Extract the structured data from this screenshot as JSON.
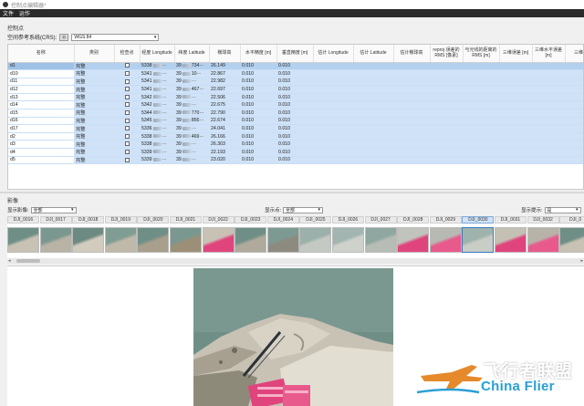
{
  "window": {
    "title": "控制点编辑器*"
  },
  "menu": [
    "文件",
    "运作"
  ],
  "control_points": {
    "section_label": "控制点",
    "crs_label": "空间参考系统(CRS):",
    "crs_value": "WGS 84",
    "columns": [
      "名称",
      "类别",
      "检查点",
      "经度 Longitude",
      "纬度 Latitude",
      "椭球高",
      "水平精度 [m]",
      "垂直精度 [m]",
      "估计 Longitude",
      "估计 Latitude",
      "估计椭球高",
      "reproj 误差的 RMS [像素]",
      "与光线的距离的 RMS [m]",
      "三维误差 [m]",
      "三维水平误差 [m]",
      "三维"
    ],
    "rows": [
      {
        "name": "d1",
        "type": "完整",
        "lon": "5338",
        "lat": "39",
        "tail": "734",
        "h": "26.149",
        "hacc": "0.010",
        "vacc": "0.010"
      },
      {
        "name": "d10",
        "type": "完整",
        "lon": "5341",
        "lat": "39",
        "tail": "10",
        "h": "22.867",
        "hacc": "0.010",
        "vacc": "0.010"
      },
      {
        "name": "d11",
        "type": "完整",
        "lon": "5341",
        "lat": "39",
        "tail": "",
        "h": "22.982",
        "hacc": "0.010",
        "vacc": "0.010"
      },
      {
        "name": "d12",
        "type": "完整",
        "lon": "5341",
        "lat": "39",
        "tail": "467",
        "h": "22.697",
        "hacc": "0.010",
        "vacc": "0.010"
      },
      {
        "name": "d13",
        "type": "完整",
        "lon": "5342",
        "lat": "39",
        "tail": "",
        "h": "22.506",
        "hacc": "0.010",
        "vacc": "0.010"
      },
      {
        "name": "d14",
        "type": "完整",
        "lon": "5342",
        "lat": "39",
        "tail": "",
        "h": "22.675",
        "hacc": "0.010",
        "vacc": "0.010"
      },
      {
        "name": "d15",
        "type": "完整",
        "lon": "5344",
        "lat": "39",
        "tail": "770",
        "h": "22.790",
        "hacc": "0.010",
        "vacc": "0.010"
      },
      {
        "name": "d16",
        "type": "完整",
        "lon": "5345",
        "lat": "39",
        "tail": "856",
        "h": "22.674",
        "hacc": "0.010",
        "vacc": "0.010"
      },
      {
        "name": "d17",
        "type": "完整",
        "lon": "5336",
        "lat": "39",
        "tail": "",
        "h": "24.041",
        "hacc": "0.010",
        "vacc": "0.010"
      },
      {
        "name": "d2",
        "type": "完整",
        "lon": "5338",
        "lat": "39",
        "tail": "469",
        "h": "26.166",
        "hacc": "0.010",
        "vacc": "0.010"
      },
      {
        "name": "d3",
        "type": "完整",
        "lon": "5338",
        "lat": "39",
        "tail": "",
        "h": "26.303",
        "hacc": "0.010",
        "vacc": "0.010"
      },
      {
        "name": "d4",
        "type": "完整",
        "lon": "5339",
        "lat": "39",
        "tail": "",
        "h": "22.193",
        "hacc": "0.010",
        "vacc": "0.010"
      },
      {
        "name": "d5",
        "type": "完整",
        "lon": "5339",
        "lat": "39",
        "tail": "",
        "h": "23.020",
        "hacc": "0.010",
        "vacc": "0.010"
      }
    ]
  },
  "images": {
    "section_label": "影像",
    "filter_images_label": "显示影像:",
    "filter_images_value": "全部",
    "filter_points_label": "显示点:",
    "filter_points_value": "全部",
    "show_hint_label": "显示提示:",
    "show_hint_value": "是",
    "thumbnails": [
      "DJI_0016",
      "DJI_0017",
      "DJI_0018",
      "DJI_0019",
      "DJI_0020",
      "DJI_0021",
      "DJI_0022",
      "DJI_0023",
      "DJI_0024",
      "DJI_0025",
      "DJI_0026",
      "DJI_0027",
      "DJI_0028",
      "DJI_0029",
      "DJI_0030",
      "DJI_0031",
      "DJI_0032",
      "DJI_0"
    ],
    "active_thumbnail": "DJI_0030"
  },
  "watermark": {
    "cn": "飞行者联盟",
    "en": "China Flier"
  },
  "colors": {
    "row_highlight": "#cfe2f7",
    "row_selected": "#b4d0ef",
    "menubar": "#2b2b2b",
    "water": "#6f8f86",
    "roof_pink": "#e0447c",
    "watermark_blue": "#2a9fd6"
  }
}
